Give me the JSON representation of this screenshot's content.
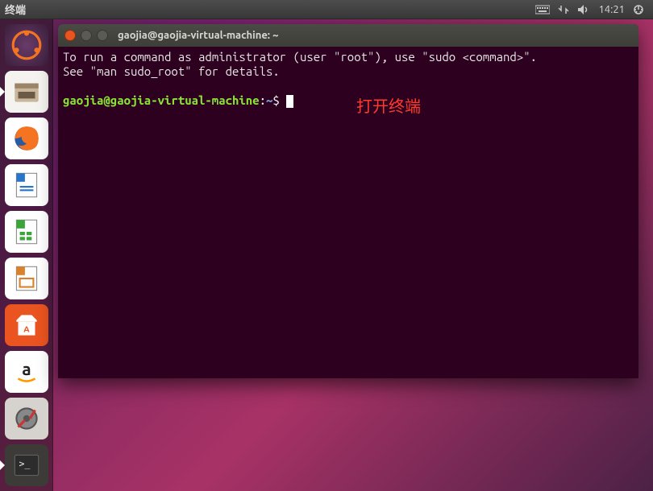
{
  "top_panel": {
    "app_title": "终端",
    "time": "14:21"
  },
  "launcher": {
    "items": [
      {
        "name": "dash",
        "label": "Dash"
      },
      {
        "name": "files",
        "label": "Files"
      },
      {
        "name": "firefox",
        "label": "Firefox"
      },
      {
        "name": "writer",
        "label": "LibreOffice Writer"
      },
      {
        "name": "calc",
        "label": "LibreOffice Calc"
      },
      {
        "name": "impress",
        "label": "LibreOffice Impress"
      },
      {
        "name": "software",
        "label": "Ubuntu Software"
      },
      {
        "name": "amazon",
        "label": "Amazon"
      },
      {
        "name": "settings",
        "label": "System Settings"
      },
      {
        "name": "terminal",
        "label": "Terminal"
      }
    ]
  },
  "window": {
    "title": "gaojia@gaojia-virtual-machine: ~"
  },
  "terminal": {
    "motd_line1": "To run a command as administrator (user \"root\"), use \"sudo <command>\".",
    "motd_line2": "See \"man sudo_root\" for details.",
    "prompt_user": "gaojia@gaojia-virtual-machine",
    "prompt_colon": ":",
    "prompt_path": "~",
    "prompt_dollar": "$ "
  },
  "annotation": {
    "text": "打开终端"
  }
}
